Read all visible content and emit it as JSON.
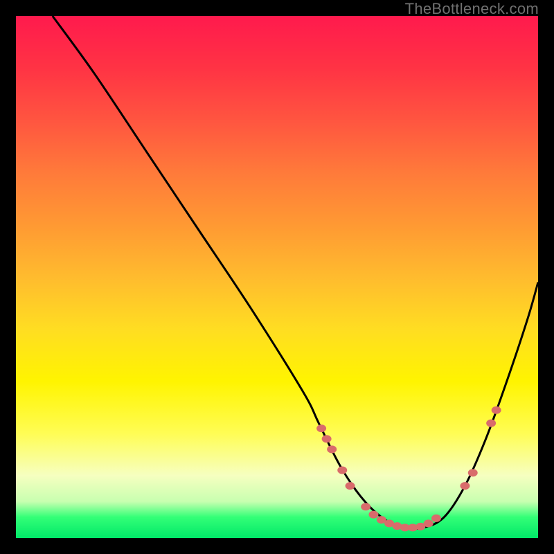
{
  "watermark": "TheBottleneck.com",
  "chart_data": {
    "type": "line",
    "title": "",
    "xlabel": "",
    "ylabel": "",
    "xlim": [
      0,
      100
    ],
    "ylim": [
      0,
      100
    ],
    "series": [
      {
        "name": "bottleneck-curve",
        "x": [
          7,
          15,
          25,
          35,
          45,
          55,
          58,
          62,
          66,
          70,
          74,
          78,
          82,
          86,
          90,
          94,
          98,
          100
        ],
        "y": [
          100,
          89,
          74,
          59,
          44,
          28,
          22,
          14,
          8,
          4,
          2,
          2,
          4,
          10,
          19,
          30,
          42,
          49
        ]
      }
    ],
    "markers": [
      {
        "x": 58.5,
        "y": 21
      },
      {
        "x": 59.5,
        "y": 19
      },
      {
        "x": 60.5,
        "y": 17
      },
      {
        "x": 62.5,
        "y": 13
      },
      {
        "x": 64,
        "y": 10
      },
      {
        "x": 67,
        "y": 6
      },
      {
        "x": 68.5,
        "y": 4.5
      },
      {
        "x": 70,
        "y": 3.5
      },
      {
        "x": 71.5,
        "y": 2.8
      },
      {
        "x": 73,
        "y": 2.3
      },
      {
        "x": 74.5,
        "y": 2
      },
      {
        "x": 76,
        "y": 2
      },
      {
        "x": 77.5,
        "y": 2.2
      },
      {
        "x": 79,
        "y": 2.8
      },
      {
        "x": 80.5,
        "y": 3.8
      },
      {
        "x": 86,
        "y": 10
      },
      {
        "x": 87.5,
        "y": 12.5
      },
      {
        "x": 91,
        "y": 22
      },
      {
        "x": 92,
        "y": 24.5
      }
    ]
  }
}
